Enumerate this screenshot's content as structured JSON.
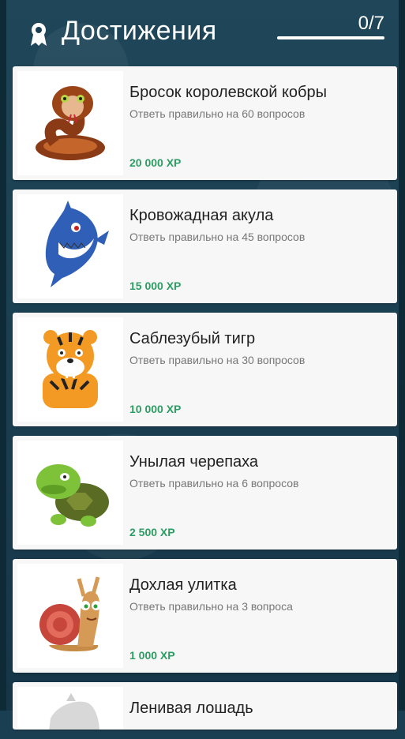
{
  "header": {
    "title": "Достижения",
    "counter": "0/7",
    "progress_fraction": 0
  },
  "achievements": [
    {
      "name": "Бросок королевской кобры",
      "desc": "Ответь правильно на 60 вопросов",
      "xp": "20 000 XP",
      "icon": "cobra-icon"
    },
    {
      "name": "Кровожадная акула",
      "desc": "Ответь правильно на 45 вопросов",
      "xp": "15 000 XP",
      "icon": "shark-icon"
    },
    {
      "name": "Саблезубый тигр",
      "desc": "Ответь правильно на 30 вопросов",
      "xp": "10 000 XP",
      "icon": "tiger-icon"
    },
    {
      "name": "Унылая черепаха",
      "desc": "Ответь правильно на 6 вопросов",
      "xp": "2 500 XP",
      "icon": "turtle-icon"
    },
    {
      "name": "Дохлая улитка",
      "desc": "Ответь правильно на 3 вопроса",
      "xp": "1 000 XP",
      "icon": "snail-icon"
    },
    {
      "name": "Ленивая лошадь",
      "icon": "horse-icon"
    }
  ]
}
